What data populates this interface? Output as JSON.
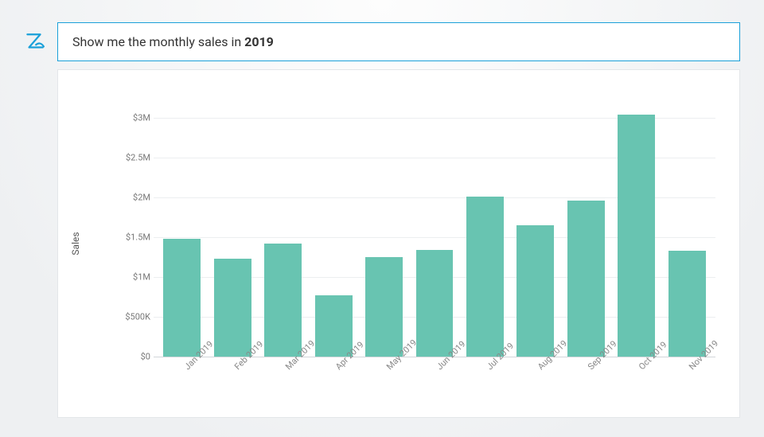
{
  "header": {
    "logo_alt": "zia",
    "query_leading": "Show me the monthly sales in ",
    "query_bold": "2019"
  },
  "chart": {
    "ylabel": "Sales",
    "y_ticks": [
      "$0",
      "$500K",
      "$1M",
      "$1.5M",
      "$2M",
      "$2.5M",
      "$3M"
    ],
    "bar_color": "#68c4b1"
  },
  "chart_data": {
    "type": "bar",
    "title": "",
    "xlabel": "",
    "ylabel": "Sales",
    "ylim": [
      0,
      3200000
    ],
    "y_ticks": [
      0,
      500000,
      1000000,
      1500000,
      2000000,
      2500000,
      3000000
    ],
    "categories": [
      "Jan 2019",
      "Feb 2019",
      "Mar 2019",
      "Apr 2019",
      "May 2019",
      "Jun 2019",
      "Jul 2019",
      "Aug 2019",
      "Sep 2019",
      "Oct 2019",
      "Nov 2019"
    ],
    "values": [
      1480000,
      1230000,
      1420000,
      770000,
      1250000,
      1340000,
      2010000,
      1650000,
      1960000,
      3040000,
      1330000
    ]
  }
}
